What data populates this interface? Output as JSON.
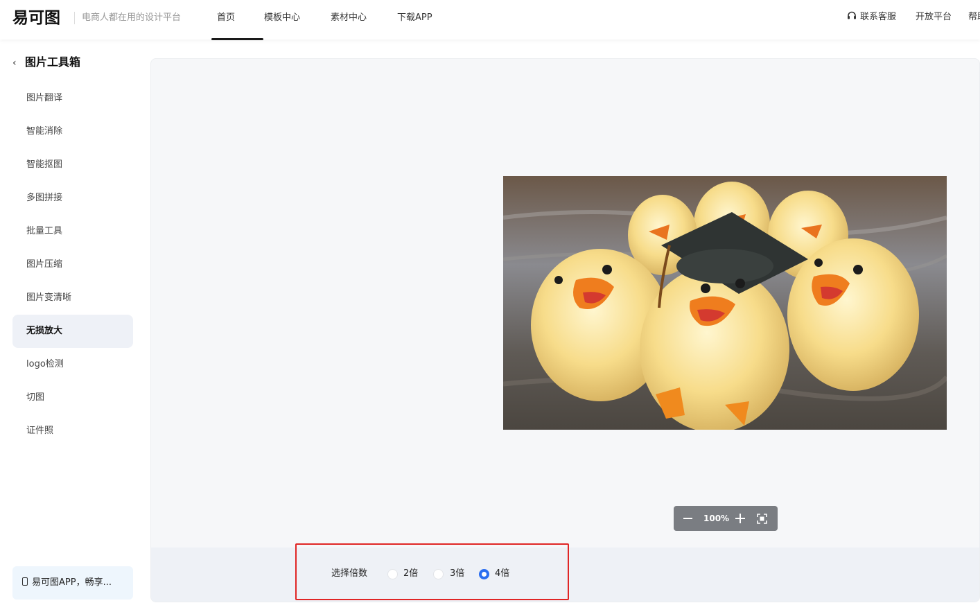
{
  "header": {
    "logo": "易可图",
    "slogan": "电商人都在用的设计平台",
    "nav": [
      {
        "label": "首页",
        "active": true
      },
      {
        "label": "模板中心"
      },
      {
        "label": "素材中心"
      },
      {
        "label": "下载APP"
      }
    ],
    "right": {
      "service": "联系客服",
      "open_platform": "开放平台",
      "help": "帮助"
    }
  },
  "sidebar": {
    "title": "图片工具箱",
    "items": [
      {
        "label": "图片翻译"
      },
      {
        "label": "智能消除"
      },
      {
        "label": "智能抠图"
      },
      {
        "label": "多图拼接"
      },
      {
        "label": "批量工具"
      },
      {
        "label": "图片压缩"
      },
      {
        "label": "图片变清晰"
      },
      {
        "label": "无损放大",
        "active": true
      },
      {
        "label": "logo检测"
      },
      {
        "label": "切图"
      },
      {
        "label": "证件照"
      }
    ],
    "promo": "易可图APP，畅享..."
  },
  "canvas": {
    "zoom": "100%"
  },
  "scale_options": {
    "label": "选择倍数",
    "options": [
      {
        "label": "2倍",
        "checked": false
      },
      {
        "label": "3倍",
        "checked": false
      },
      {
        "label": "4倍",
        "checked": true
      }
    ]
  },
  "colors": {
    "accent": "#2a6ef0",
    "highlight_border": "#e02525",
    "active_item_bg": "#eef1f7"
  }
}
